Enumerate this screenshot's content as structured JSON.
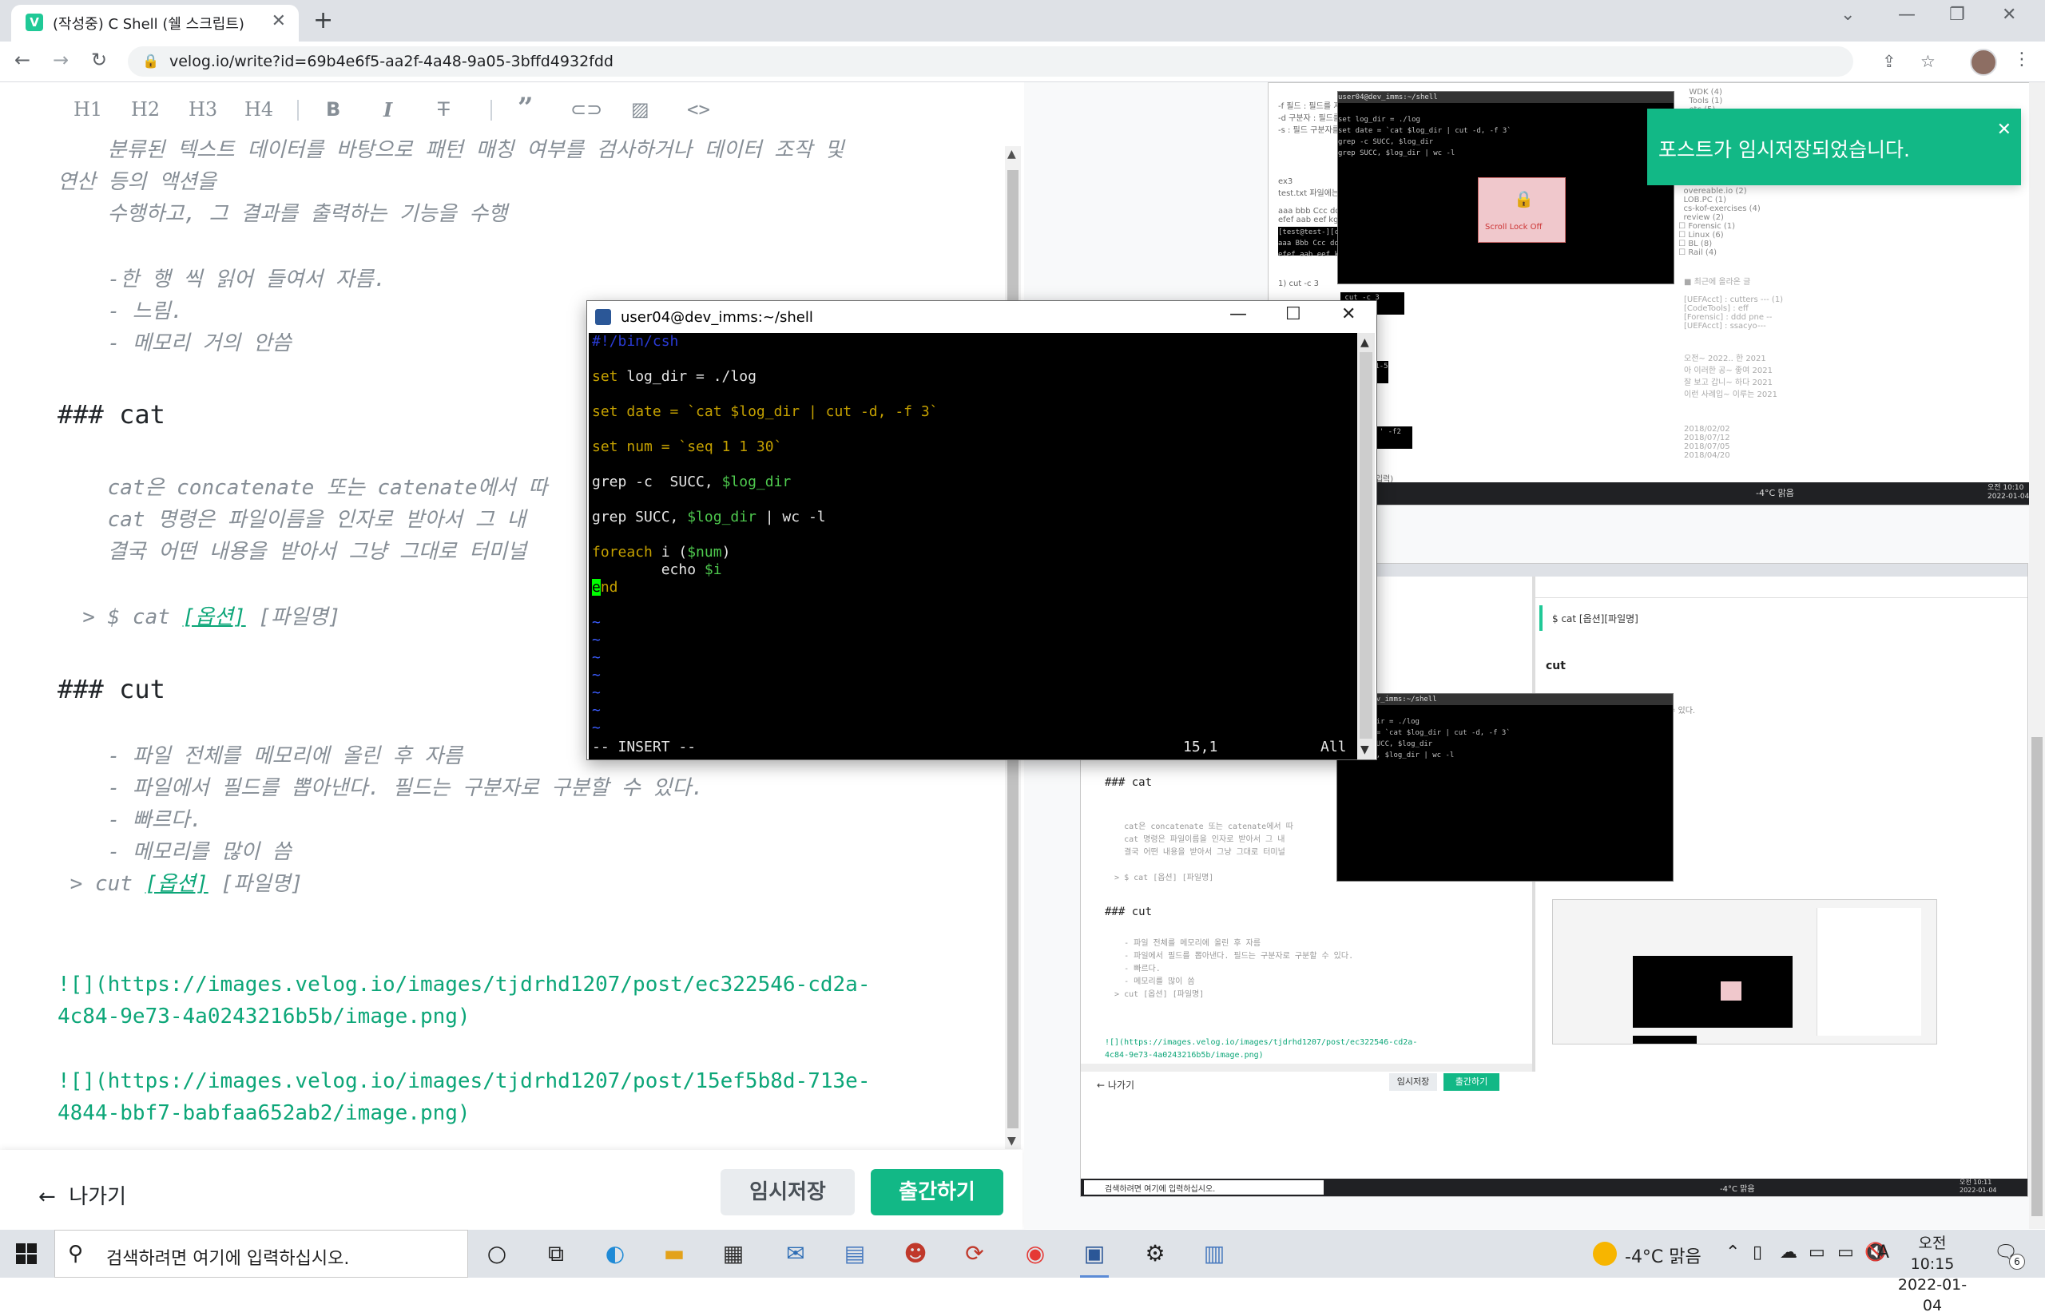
{
  "browser": {
    "tab_title": "(작성중) C Shell (쉘 스크립트)",
    "tab_favicon": "V",
    "tab_close": "✕",
    "new_tab": "+",
    "url": "velog.io/write?id=69b4e6f5-aa2f-4a48-9a05-3bffd4932fdd"
  },
  "editor": {
    "toolbar": [
      "H1",
      "H2",
      "H3",
      "H4"
    ],
    "lines": [
      "    분류된 텍스트 데이터를 바탕으로 패턴 매칭 여부를 검사하거나 데이터 조작 및",
      "연산 등의 액션을",
      "    수행하고, 그 결과를 출력하는 기능을 수행",
      "    -한 행 씩 읽어 들여서 자름.",
      "    - 느림.",
      "    - 메모리 거의 안씀",
      "    cat은 concatenate 또는 catenate에서 따",
      "    cat 명령은 파일이름을 인자로 받아서 그 내",
      "    결국 어떤 내용을 받아서 그냥 그대로 터미널",
      "    - 파일 전체를 메모리에 올린 후 자름",
      "    - 파일에서 필드를 뽑아낸다. 필드는 구분자로 구분할 수 있다.",
      "    - 빠르다.",
      "    - 메모리를 많이 씀"
    ],
    "heading_cat": "### cat",
    "heading_cut": "### cut",
    "cat_syntax": {
      "prefix": "  > $ cat ",
      "opt": "[옵션]",
      "file": " [파일명]"
    },
    "cut_syntax": {
      "prefix": " > cut ",
      "opt": "[옵션]",
      "file": " [파일명]"
    },
    "image_links": [
      [
        "![](https://images.velog.io/images/tjdrhd1207/post/ec322546-cd2a-",
        "4c84-9e73-4a0243216b5b/image.png)"
      ],
      [
        "![](https://images.velog.io/images/tjdrhd1207/post/15ef5b8d-713e-",
        "4844-bbf7-babfaa652ab2/image.png)"
      ]
    ]
  },
  "footer": {
    "exit_label": "나가기",
    "save_label": "임시저장",
    "publish_label": "출간하기"
  },
  "toast": {
    "message": "포스트가 임시저장되었습니다.",
    "close": "✕",
    "color": "#12b886"
  },
  "terminal": {
    "title": "user04@dev_imms:~/shell",
    "lines": {
      "shebang": "#!/bin/csh",
      "set1_kw": "set",
      "set1_rest": " log_dir = ./log",
      "set2_kw": "set",
      "set2_a": " date = `cat ",
      "set2_var": "$log_dir",
      "set2_b": " | cut -d, -f 3`",
      "set3_kw": "set",
      "set3_rest": " num = `seq 1 1 30`",
      "grep1_a": "grep -c  SUCC, ",
      "grep1_var": "$log_dir",
      "grep2_a": "grep SUCC, ",
      "grep2_var": "$log_dir",
      "grep2_b": " | wc -l",
      "foreach_kw": "foreach",
      "foreach_a": " i (",
      "foreach_var": "$num",
      "foreach_b": ")",
      "echo_a": "        echo ",
      "echo_var": "$i",
      "end_cursor": "e",
      "end_rest": "nd",
      "tilde": "~"
    },
    "status_mode": "-- INSERT --",
    "status_pos": "15,1",
    "status_all": "All"
  },
  "preview": {
    "scroll_lock": "Scroll Lock Off",
    "mini_heading_cat": "### cat",
    "mini_heading_cut": "### cut",
    "mini_quote": "$ cat [옵션][파일명]",
    "mini_cut": "cut",
    "mini_exit": "← 나가기",
    "mini_save": "임시저장",
    "mini_publish": "출간하기",
    "mini_search": "검색하려면 여기에 입력하십시오.",
    "mini_weather": "-4°C 맑음",
    "mini_time_top": "오전 10:10",
    "mini_date_top": "2022-01-04",
    "mini_time_bottom": "오전 10:11",
    "mini_date_bottom": "2022-01-04",
    "mini_link": "![](https://images.velog.io/images/tjdrhd1207/post/ec322546-cd2a-\n4c84-9e73-4a0243216b5b/image.png)",
    "mini_term_lines": "set log_dir = ./log\nset date = `cat $log_dir | cut -d, -f 3`\ngrep -c SUCC, $log_dir\ngrep SUCC, $log_dir | wc -l",
    "mini_term_title": "user04@dev_imms:~/shell",
    "mini_code_cat": "    cat은 concatenate 또는 catenate에서 따\n    cat 명령은 파일이름을 인자로 받아서 그 내\n    결국 어떤 내용을 받아서 그냥 그대로 터미널\n\n  > $ cat [옵션] [파일명]",
    "mini_code_cut": "    - 파일 전체를 메모리에 올린 후 자름\n    - 파일에서 필드를 뽑아낸다. 필드는 구분자로 구분할 수 있다.\n    - 빠르다.\n    - 메모리를 많이 씀\n  > cut [옵션] [파일명]"
  },
  "taskbar": {
    "search_placeholder": "검색하려면 여기에 입력하십시오.",
    "weather": "-4°C  맑음",
    "ime": "A",
    "time": "오전 10:15",
    "date": "2022-01-04",
    "notif_count": "6"
  }
}
